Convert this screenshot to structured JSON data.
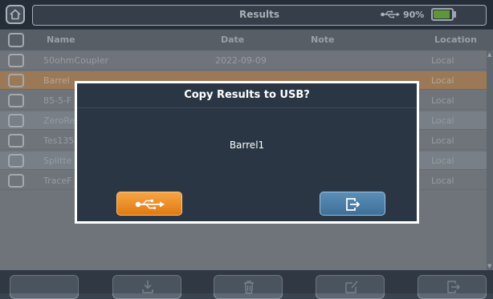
{
  "header": {
    "title": "Results",
    "battery_percent": "90%",
    "battery_level": 0.9,
    "usb_status_icon": "usb-icon",
    "home_icon": "home-icon"
  },
  "table": {
    "columns": [
      "Name",
      "Date",
      "Note",
      "Location"
    ],
    "rows": [
      {
        "name": "50ohmCoupler",
        "date": "2022-09-09",
        "note": "",
        "location": "Local",
        "highlighted": false
      },
      {
        "name": "Barrel",
        "date": "",
        "note": "",
        "location": "Local",
        "highlighted": true
      },
      {
        "name": "85-5-F",
        "date": "",
        "note": "",
        "location": "Local",
        "highlighted": false
      },
      {
        "name": "ZeroRe",
        "date": "",
        "note": "",
        "location": "Local",
        "highlighted": false
      },
      {
        "name": "Tes135",
        "date": "",
        "note": "",
        "location": "Local",
        "highlighted": false
      },
      {
        "name": "Splitte",
        "date": "",
        "note": "",
        "location": "Local",
        "highlighted": false
      },
      {
        "name": "TraceF",
        "date": "",
        "note": "",
        "location": "Local",
        "highlighted": false
      }
    ]
  },
  "toolbar": {
    "icons": [
      "blank",
      "download-icon",
      "trash-icon",
      "edit-icon",
      "exit-icon"
    ]
  },
  "dialog": {
    "title": "Copy Results to USB?",
    "message": "Barrel1",
    "confirm_icon": "usb-icon",
    "cancel_icon": "exit-icon"
  },
  "colors": {
    "highlight_row": "#c99a6a",
    "confirm_button": "#f0901f",
    "cancel_button": "#4c80aa",
    "battery_fill": "#77c043"
  }
}
